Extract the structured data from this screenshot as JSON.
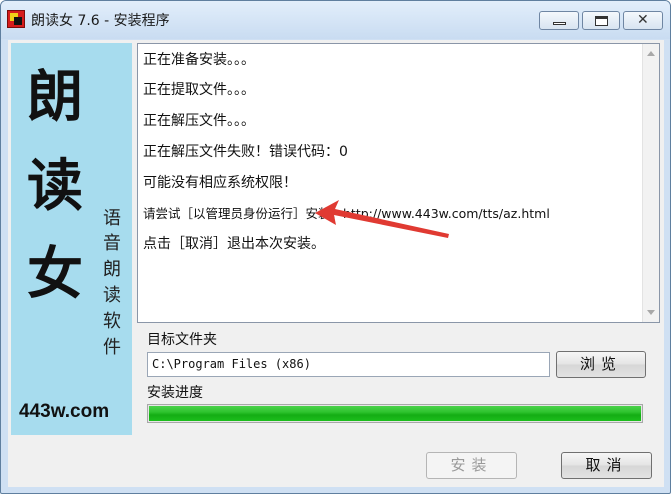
{
  "window": {
    "title": "朗读女 7.6 - 安装程序",
    "close_glyph": "✕"
  },
  "sidebar": {
    "big_chars": [
      "朗",
      "读",
      "女"
    ],
    "small_chars": [
      "语",
      "音",
      "朗",
      "读",
      "软",
      "件"
    ],
    "site": "443w.com"
  },
  "log": {
    "lines": [
      "正在准备安装。。。",
      "正在提取文件。。。",
      "正在解压文件。。。",
      "正在解压文件失败！错误代码：0",
      "可能没有相应系统权限！",
      "请尝试［以管理员身份运行］安装：http://www.443w.com/tts/az.html",
      "点击［取消］退出本次安装。"
    ]
  },
  "target_folder": {
    "label": "目标文件夹",
    "value": "C:\\Program Files (x86)"
  },
  "buttons": {
    "browse": "浏览",
    "install": "安装",
    "cancel": "取消"
  },
  "progress": {
    "label": "安装进度",
    "percent": 100,
    "fill_color": "#22b922"
  },
  "annotation": {
    "arrow_color": "#e03a32"
  }
}
